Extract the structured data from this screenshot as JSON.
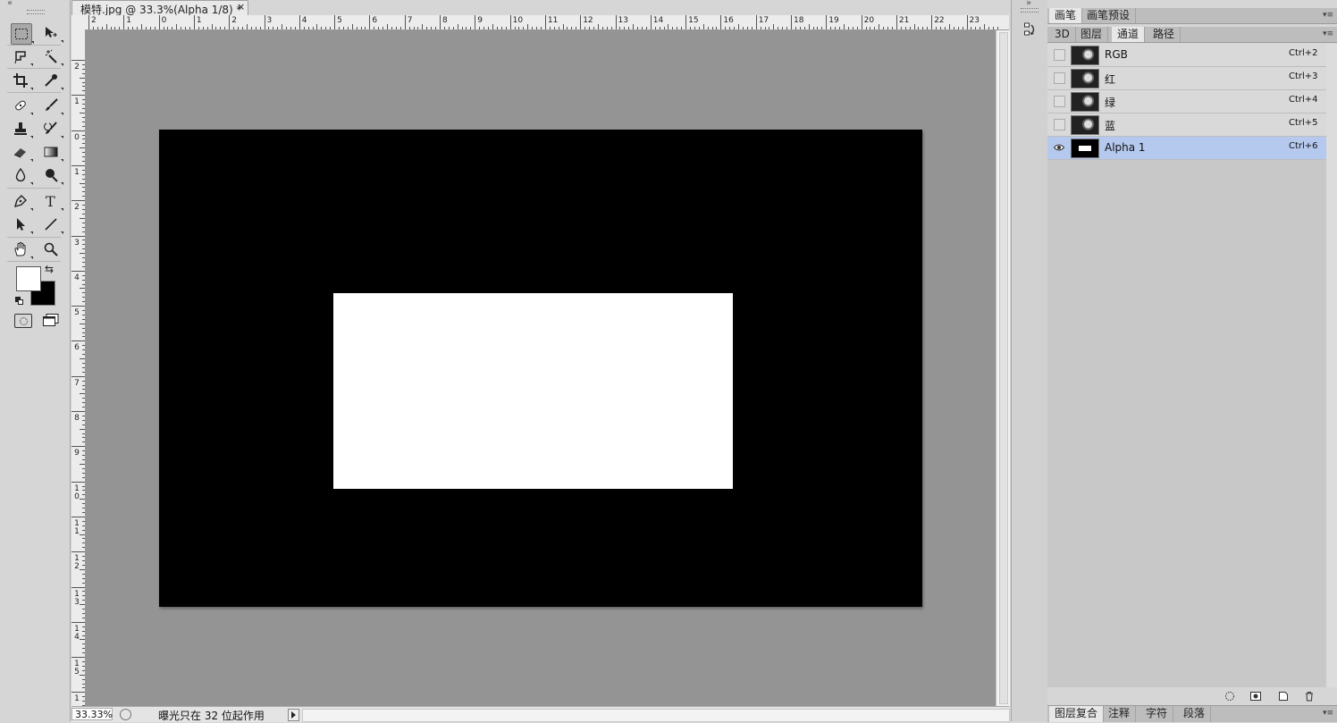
{
  "document": {
    "tab_title": "模特.jpg @ 33.3%(Alpha 1/8) *",
    "close_glyph": "×"
  },
  "rulers": {
    "top_labels": [
      "2",
      "1",
      "0",
      "1",
      "2",
      "3",
      "4",
      "5",
      "6",
      "7",
      "8",
      "9",
      "10",
      "11",
      "12",
      "13",
      "14",
      "15",
      "16",
      "17",
      "18",
      "19",
      "20",
      "21",
      "22",
      "23"
    ],
    "left_labels": [
      "2",
      "1",
      "0",
      "1",
      "2",
      "3",
      "4",
      "5",
      "6",
      "7",
      "8",
      "9",
      "10",
      "11",
      "12",
      "13",
      "14",
      "15",
      "1"
    ]
  },
  "canvas": {
    "image_color": "#000000",
    "selection_color": "#ffffff",
    "pasteboard_color": "#949494"
  },
  "status": {
    "zoom": "33.33%",
    "info": "曝光只在 32 位起作用"
  },
  "panels": {
    "top_tabs": [
      "画笔",
      "画笔预设"
    ],
    "channel_tabs": [
      "3D",
      "图层",
      "通道",
      "路径"
    ],
    "active_channel_tab": "通道",
    "channels": [
      {
        "name": "RGB",
        "shortcut": "Ctrl+2",
        "visible": false
      },
      {
        "name": "红",
        "shortcut": "Ctrl+3",
        "visible": false
      },
      {
        "name": "绿",
        "shortcut": "Ctrl+4",
        "visible": false
      },
      {
        "name": "蓝",
        "shortcut": "Ctrl+5",
        "visible": false
      },
      {
        "name": "Alpha 1",
        "shortcut": "Ctrl+6",
        "visible": true,
        "selected": true
      }
    ],
    "bottom_tabs": [
      "图层复合",
      "注释",
      "字符",
      "段落"
    ]
  },
  "colors": {
    "foreground": "#ffffff",
    "background": "#000000",
    "selected_row": "#b5c9ef"
  },
  "icons": {
    "tools": [
      "rectangular-marquee",
      "move",
      "lasso",
      "magic-wand",
      "crop",
      "eyedropper",
      "spot-healing-brush",
      "brush",
      "clone-stamp",
      "history-brush",
      "eraser",
      "gradient",
      "dodge",
      "burn",
      "pen",
      "type",
      "path-selection",
      "line",
      "hand",
      "zoom"
    ]
  }
}
